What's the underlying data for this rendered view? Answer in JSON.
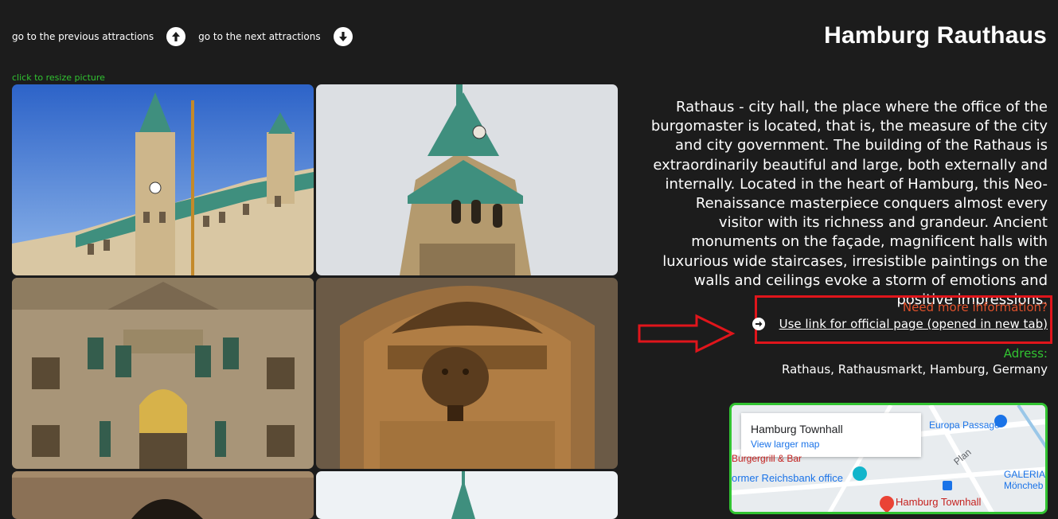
{
  "nav": {
    "prev_label": "go to the previous attractions",
    "next_label": "go to the next attractions"
  },
  "title": "Hamburg Rauthaus",
  "gallery": {
    "resize_hint": "click to resize picture"
  },
  "description": "Rathaus - city hall, the place where the office of the burgomaster is located, that is, the measure of the city and city government. The building of the Rathaus is extraordinarily beautiful and large, both externally and internally. Located in the heart of Hamburg, this Neo-Renaissance masterpiece conquers almost every visitor with its richness and grandeur. Ancient monuments on the façade, magnificent halls with luxurious wide staircases, irresistible paintings on the walls and ceilings evoke a storm of emotions and positive impressions.",
  "info": {
    "question": "Need more information?",
    "link_label": "Use link for official page (opened in new tab)"
  },
  "address": {
    "label": "Adress:",
    "value": "Rathaus, Rathausmarkt, Hamburg, Germany"
  },
  "map": {
    "place_name": "Hamburg Townhall",
    "larger_map": "View larger map",
    "labels": {
      "europa": "Europa Passage",
      "burgergrill": "Burgergrill & Bar",
      "reichsbank": "ormer Reichsbank office",
      "galeria": "GALERIA",
      "monckeb": "Möncheb",
      "plan": "Plan",
      "pin_label": "Hamburg Townhall"
    }
  },
  "colors": {
    "accent_green": "#31c331",
    "info_orange": "#e0512b",
    "highlight_red": "#e0151b"
  }
}
